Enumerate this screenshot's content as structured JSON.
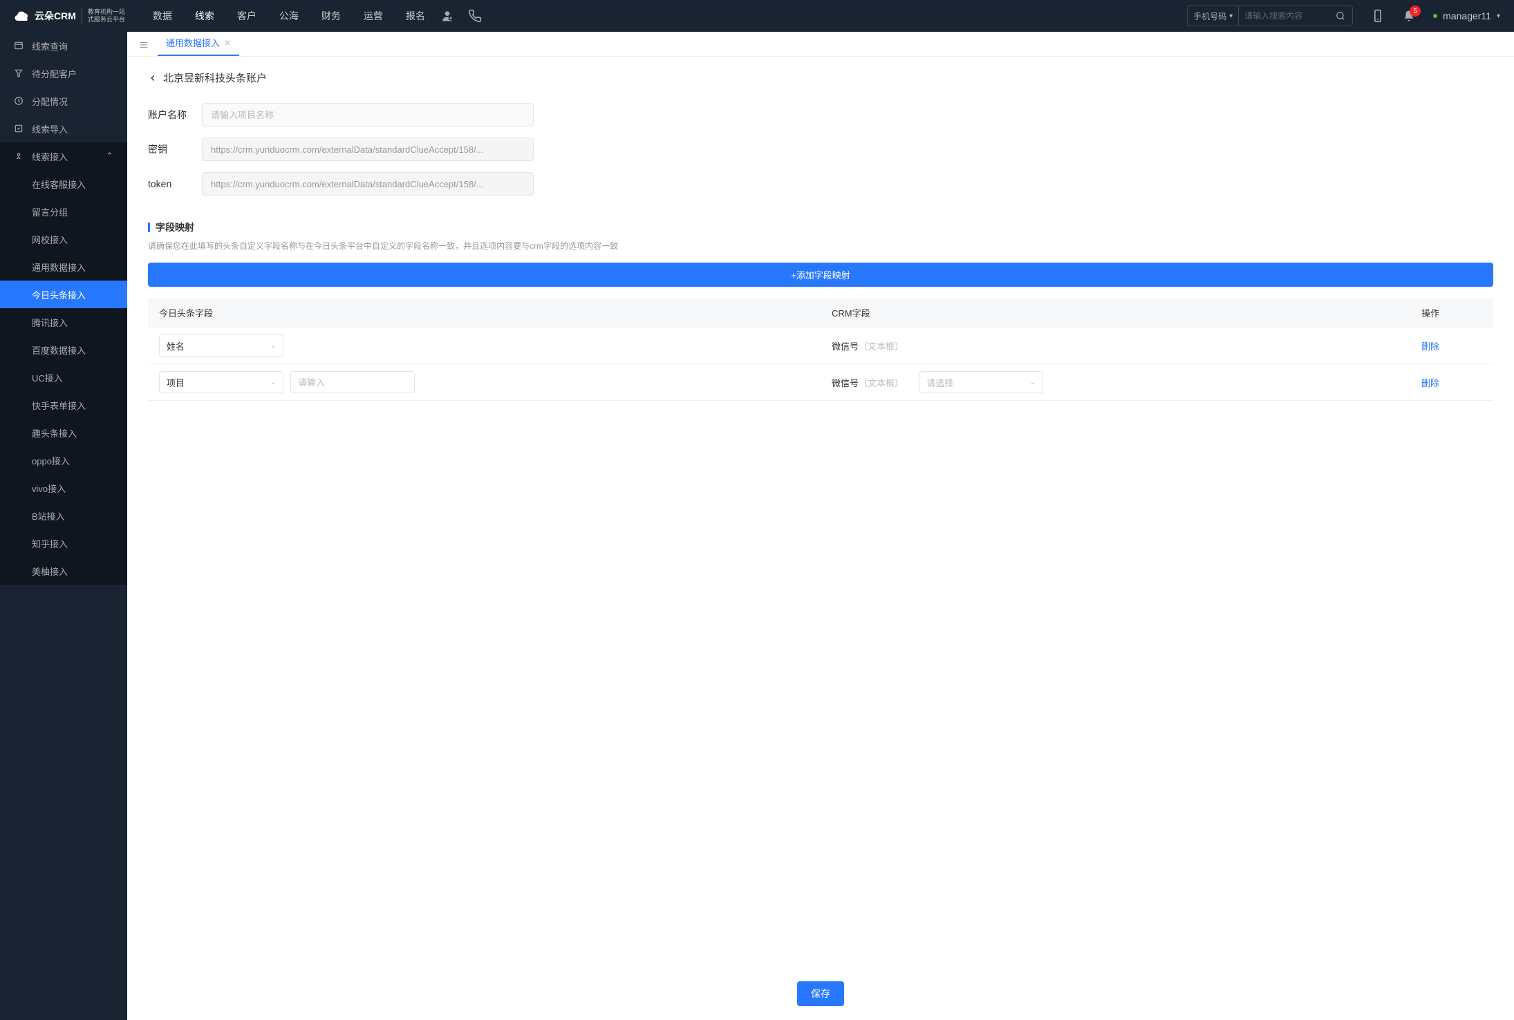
{
  "header": {
    "logo_brand": "云朵CRM",
    "logo_sub1": "教育机构一站",
    "logo_sub2": "式服务云平台",
    "nav": [
      "数据",
      "线索",
      "客户",
      "公海",
      "财务",
      "运营",
      "报名"
    ],
    "nav_active_index": 1,
    "search_type": "手机号码",
    "search_placeholder": "请输入搜索内容",
    "badge_count": "5",
    "username": "manager11"
  },
  "sidebar": {
    "items": [
      {
        "label": "线索查询"
      },
      {
        "label": "待分配客户"
      },
      {
        "label": "分配情况"
      },
      {
        "label": "线索导入"
      },
      {
        "label": "线索接入",
        "expanded": true
      }
    ],
    "sub_items": [
      "在线客服接入",
      "留言分组",
      "网校接入",
      "通用数据接入",
      "今日头条接入",
      "腾讯接入",
      "百度数据接入",
      "UC接入",
      "快手表单接入",
      "趣头条接入",
      "oppo接入",
      "vivo接入",
      "B站接入",
      "知乎接入",
      "美柚接入"
    ],
    "sub_active_index": 4
  },
  "tabs": {
    "active": "通用数据接入"
  },
  "page": {
    "title": "北京昱新科技头条账户",
    "form": {
      "account_label": "账户名称",
      "account_placeholder": "请输入项目名称",
      "secret_label": "密钥",
      "secret_value": "https://crm.yunduocrm.com/externalData/standardClueAccept/158/...",
      "token_label": "token",
      "token_value": "https://crm.yunduocrm.com/externalData/standardClueAccept/158/..."
    },
    "mapping": {
      "title": "字段映射",
      "desc": "请确保您在此填写的头条自定义字段名称与在今日头条平台中自定义的字段名称一致，并且选项内容要与crm字段的选项内容一致",
      "add_btn": "+添加字段映射",
      "col1": "今日头条字段",
      "col2": "CRM字段",
      "col3": "操作",
      "rows": [
        {
          "tt_field": "姓名",
          "crm_name": "微信号",
          "crm_hint": "（文本框）",
          "delete": "删除"
        },
        {
          "tt_field": "项目",
          "tt_input_placeholder": "请输入",
          "crm_name": "微信号",
          "crm_hint": "（文本框）",
          "crm_select_placeholder": "请选择",
          "delete": "删除"
        }
      ]
    },
    "save": "保存"
  }
}
